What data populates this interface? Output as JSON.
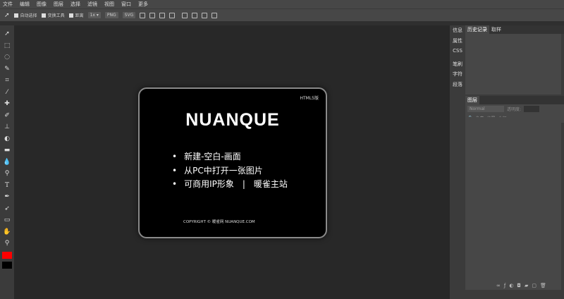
{
  "menu": [
    "文件",
    "编辑",
    "图像",
    "图层",
    "选择",
    "滤镜",
    "视图",
    "窗口",
    "更多"
  ],
  "options": {
    "auto_select": "自动选择",
    "transform": "变换工具",
    "distance": "距离",
    "scale": "1x ▾",
    "png": "PNG",
    "svg": "SVG"
  },
  "tools": [
    "move",
    "marquee",
    "lasso",
    "quick-select",
    "crop",
    "eyedropper",
    "healing",
    "brush",
    "stamp",
    "eraser",
    "gradient",
    "blur",
    "dodge",
    "text",
    "pen",
    "path-select",
    "shape",
    "hand",
    "zoom"
  ],
  "colors": {
    "foreground": "#ff0000",
    "background": "#000000"
  },
  "card": {
    "badge": "HTML5版",
    "logo": "NUANQUE",
    "items": [
      "新建-空白-画面",
      "从PC中打开一张图片",
      "可商用IP形象　|　暖雀主站"
    ],
    "copyright": "COPYRIGHT © 暖雀网 NUANQUE.COM"
  },
  "side_tabs": [
    "信息",
    "属性",
    "CSS",
    "笔刷",
    "字符",
    "段落"
  ],
  "history_tabs": [
    "历史记录",
    "取样"
  ],
  "layers": {
    "tab": "图层",
    "blend": "Normal",
    "opacity_label": "透明度:",
    "lock": [
      "像素",
      "位置",
      "全部"
    ]
  }
}
